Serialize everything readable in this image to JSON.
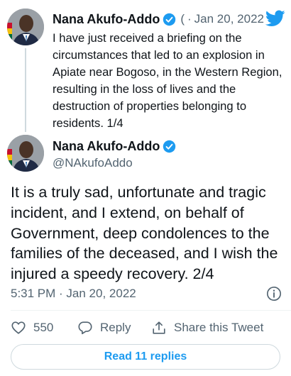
{
  "colors": {
    "accent": "#1d9bf0",
    "secondary_text": "#536471",
    "primary_text": "#0f1419"
  },
  "tweet1": {
    "author_name": "Nana Akufo-Addo",
    "handle_truncated": "(",
    "separator": "·",
    "date": "Jan 20, 2022",
    "text": "I have just received a briefing on the circumstances that led to an explosion in Apiate near Bogoso, in the Western Region, resulting in the loss of lives and the destruction of properties belonging to residents. 1/4"
  },
  "tweet2": {
    "author_name": "Nana Akufo-Addo",
    "handle": "@NAkufoAddo",
    "text": "It is a truly sad, unfortunate and tragic incident, and I extend, on behalf of Government, deep condolences to the families of the deceased, and I wish the injured a speedy recovery. 2/4",
    "timestamp": "5:31 PM · Jan 20, 2022",
    "like_count": "550",
    "reply_label": "Reply",
    "share_label": "Share this Tweet",
    "read_replies_label": "Read 11 replies"
  },
  "icons": [
    "verified-badge-icon",
    "twitter-bird-icon",
    "info-icon",
    "heart-icon",
    "reply-bubble-icon",
    "share-icon"
  ]
}
